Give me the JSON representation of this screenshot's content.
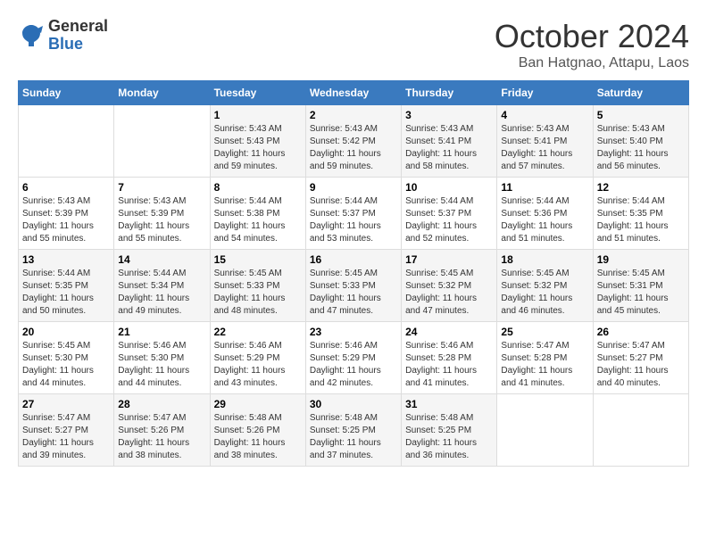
{
  "logo": {
    "general": "General",
    "blue": "Blue"
  },
  "title": "October 2024",
  "location": "Ban Hatgnao, Attapu, Laos",
  "days_of_week": [
    "Sunday",
    "Monday",
    "Tuesday",
    "Wednesday",
    "Thursday",
    "Friday",
    "Saturday"
  ],
  "weeks": [
    [
      {
        "day": "",
        "info": ""
      },
      {
        "day": "",
        "info": ""
      },
      {
        "day": "1",
        "info": "Sunrise: 5:43 AM\nSunset: 5:43 PM\nDaylight: 11 hours and 59 minutes."
      },
      {
        "day": "2",
        "info": "Sunrise: 5:43 AM\nSunset: 5:42 PM\nDaylight: 11 hours and 59 minutes."
      },
      {
        "day": "3",
        "info": "Sunrise: 5:43 AM\nSunset: 5:41 PM\nDaylight: 11 hours and 58 minutes."
      },
      {
        "day": "4",
        "info": "Sunrise: 5:43 AM\nSunset: 5:41 PM\nDaylight: 11 hours and 57 minutes."
      },
      {
        "day": "5",
        "info": "Sunrise: 5:43 AM\nSunset: 5:40 PM\nDaylight: 11 hours and 56 minutes."
      }
    ],
    [
      {
        "day": "6",
        "info": "Sunrise: 5:43 AM\nSunset: 5:39 PM\nDaylight: 11 hours and 55 minutes."
      },
      {
        "day": "7",
        "info": "Sunrise: 5:43 AM\nSunset: 5:39 PM\nDaylight: 11 hours and 55 minutes."
      },
      {
        "day": "8",
        "info": "Sunrise: 5:44 AM\nSunset: 5:38 PM\nDaylight: 11 hours and 54 minutes."
      },
      {
        "day": "9",
        "info": "Sunrise: 5:44 AM\nSunset: 5:37 PM\nDaylight: 11 hours and 53 minutes."
      },
      {
        "day": "10",
        "info": "Sunrise: 5:44 AM\nSunset: 5:37 PM\nDaylight: 11 hours and 52 minutes."
      },
      {
        "day": "11",
        "info": "Sunrise: 5:44 AM\nSunset: 5:36 PM\nDaylight: 11 hours and 51 minutes."
      },
      {
        "day": "12",
        "info": "Sunrise: 5:44 AM\nSunset: 5:35 PM\nDaylight: 11 hours and 51 minutes."
      }
    ],
    [
      {
        "day": "13",
        "info": "Sunrise: 5:44 AM\nSunset: 5:35 PM\nDaylight: 11 hours and 50 minutes."
      },
      {
        "day": "14",
        "info": "Sunrise: 5:44 AM\nSunset: 5:34 PM\nDaylight: 11 hours and 49 minutes."
      },
      {
        "day": "15",
        "info": "Sunrise: 5:45 AM\nSunset: 5:33 PM\nDaylight: 11 hours and 48 minutes."
      },
      {
        "day": "16",
        "info": "Sunrise: 5:45 AM\nSunset: 5:33 PM\nDaylight: 11 hours and 47 minutes."
      },
      {
        "day": "17",
        "info": "Sunrise: 5:45 AM\nSunset: 5:32 PM\nDaylight: 11 hours and 47 minutes."
      },
      {
        "day": "18",
        "info": "Sunrise: 5:45 AM\nSunset: 5:32 PM\nDaylight: 11 hours and 46 minutes."
      },
      {
        "day": "19",
        "info": "Sunrise: 5:45 AM\nSunset: 5:31 PM\nDaylight: 11 hours and 45 minutes."
      }
    ],
    [
      {
        "day": "20",
        "info": "Sunrise: 5:45 AM\nSunset: 5:30 PM\nDaylight: 11 hours and 44 minutes."
      },
      {
        "day": "21",
        "info": "Sunrise: 5:46 AM\nSunset: 5:30 PM\nDaylight: 11 hours and 44 minutes."
      },
      {
        "day": "22",
        "info": "Sunrise: 5:46 AM\nSunset: 5:29 PM\nDaylight: 11 hours and 43 minutes."
      },
      {
        "day": "23",
        "info": "Sunrise: 5:46 AM\nSunset: 5:29 PM\nDaylight: 11 hours and 42 minutes."
      },
      {
        "day": "24",
        "info": "Sunrise: 5:46 AM\nSunset: 5:28 PM\nDaylight: 11 hours and 41 minutes."
      },
      {
        "day": "25",
        "info": "Sunrise: 5:47 AM\nSunset: 5:28 PM\nDaylight: 11 hours and 41 minutes."
      },
      {
        "day": "26",
        "info": "Sunrise: 5:47 AM\nSunset: 5:27 PM\nDaylight: 11 hours and 40 minutes."
      }
    ],
    [
      {
        "day": "27",
        "info": "Sunrise: 5:47 AM\nSunset: 5:27 PM\nDaylight: 11 hours and 39 minutes."
      },
      {
        "day": "28",
        "info": "Sunrise: 5:47 AM\nSunset: 5:26 PM\nDaylight: 11 hours and 38 minutes."
      },
      {
        "day": "29",
        "info": "Sunrise: 5:48 AM\nSunset: 5:26 PM\nDaylight: 11 hours and 38 minutes."
      },
      {
        "day": "30",
        "info": "Sunrise: 5:48 AM\nSunset: 5:25 PM\nDaylight: 11 hours and 37 minutes."
      },
      {
        "day": "31",
        "info": "Sunrise: 5:48 AM\nSunset: 5:25 PM\nDaylight: 11 hours and 36 minutes."
      },
      {
        "day": "",
        "info": ""
      },
      {
        "day": "",
        "info": ""
      }
    ]
  ]
}
